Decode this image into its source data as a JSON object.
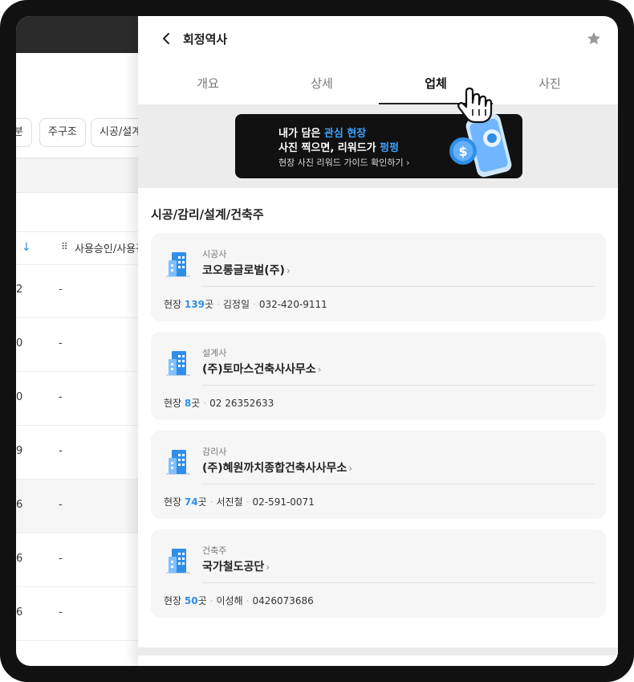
{
  "background": {
    "filters": [
      "분",
      "주구조",
      "시공/설계"
    ],
    "table_header": "사용승인/사용검사일",
    "rows": [
      {
        "num": "2",
        "value": "-"
      },
      {
        "num": "0",
        "value": "-"
      },
      {
        "num": "0",
        "value": "-"
      },
      {
        "num": "9",
        "value": "-"
      },
      {
        "num": "6",
        "value": "-"
      },
      {
        "num": "6",
        "value": "-"
      },
      {
        "num": "6",
        "value": "-"
      }
    ]
  },
  "panel": {
    "title": "회정역사",
    "tabs": [
      {
        "label": "개요"
      },
      {
        "label": "상세"
      },
      {
        "label": "업체"
      },
      {
        "label": "사진"
      }
    ],
    "active_tab": "업체",
    "banner": {
      "line1_pre": "내가 담은 ",
      "line1_hl": "관심 현장",
      "line2_pre": "사진 찍으면, 리워드가 ",
      "line2_hl": "펑펑",
      "cta": "현장 사진 리워드 가이드 확인하기 ›"
    },
    "section_title": "시공/감리/설계/건축주",
    "companies": [
      {
        "role": "시공사",
        "name": "코오롱글로벌(주)",
        "site_label": "현장",
        "sites": "139",
        "unit": "곳",
        "contact": "김정일",
        "phone": "032-420-9111"
      },
      {
        "role": "설계사",
        "name": "(주)토마스건축사사무소",
        "site_label": "현장",
        "sites": "8",
        "unit": "곳",
        "contact": "",
        "phone": "02 26352633"
      },
      {
        "role": "감리사",
        "name": "(주)혜원까치종합건축사사무소",
        "site_label": "현장",
        "sites": "74",
        "unit": "곳",
        "contact": "서진철",
        "phone": "02-591-0071"
      },
      {
        "role": "건축주",
        "name": "국가철도공단",
        "site_label": "현장",
        "sites": "50",
        "unit": "곳",
        "contact": "이성해",
        "phone": "0426073686"
      }
    ]
  },
  "colors": {
    "accent": "#2f8fe8",
    "banner_bg": "#111111",
    "frame": "#111111"
  },
  "icons": [
    "back-icon",
    "star-icon",
    "hand-pointer-icon",
    "building-icon",
    "chevron-right-icon",
    "arrow-down-icon",
    "drag-handle-icon"
  ]
}
